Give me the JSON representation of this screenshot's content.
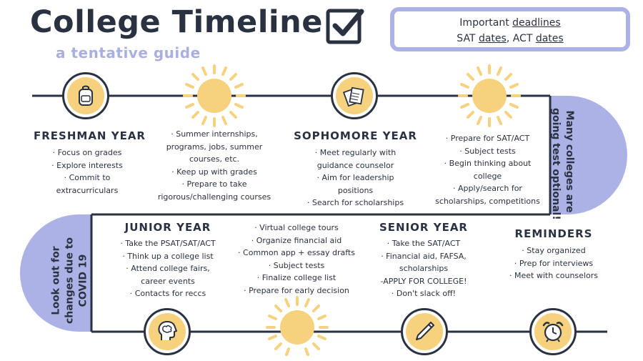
{
  "header": {
    "title": "College Timeline",
    "subtitle": "a tentative guide"
  },
  "deadlines": {
    "line1_prefix": "Important ",
    "line1_link": "deadlines",
    "line2_sat": "SAT ",
    "line2_sat_link": "dates",
    "line2_sep": ", ACT ",
    "line2_act_link": "dates"
  },
  "side_notes": {
    "right_line1": "Many colleges are",
    "right_line2": "going test optional!",
    "left_line1": "Look out for",
    "left_line2": "changes due to",
    "left_line3": "COVID 19"
  },
  "sections": {
    "freshman": {
      "heading": "FRESHMAN YEAR",
      "items": [
        "· Focus on grades",
        "· Explore interests",
        "· Commit to",
        "extracurriculars"
      ]
    },
    "summer1": {
      "items": [
        "· Summer internships,",
        "programs, jobs, summer",
        "courses, etc.",
        "· Keep up with grades",
        "· Prepare to take",
        "rigorous/challenging courses"
      ]
    },
    "sophomore": {
      "heading": "SOPHOMORE YEAR",
      "items": [
        "· Meet regularly with",
        "guidance counselor",
        "· Aim for leadership",
        "positions",
        "· Search for scholarships"
      ]
    },
    "summer2": {
      "items": [
        "· Prepare for SAT/ACT",
        "· Subject tests",
        "· Begin thinking about",
        "college",
        "· Apply/search for",
        "scholarships, competitions"
      ]
    },
    "junior": {
      "heading": "JUNIOR YEAR",
      "items": [
        "· Take the PSAT/SAT/ACT",
        "· Think up a college list",
        "· Attend college fairs,",
        "career events",
        "· Contacts for reccs"
      ]
    },
    "summer3": {
      "items": [
        "· Virtual college tours",
        "· Organize financial aid",
        "· Common app + essay drafts",
        "· Subject tests",
        "· Finalize college list",
        "· Prepare for early decision"
      ]
    },
    "senior": {
      "heading": "SENIOR YEAR",
      "items": [
        "· Take the SAT/ACT",
        "· Financial aid, FAFSA,",
        "scholarships",
        "-APPLY FOR COLLEGE!",
        "· Don't slack off!"
      ]
    },
    "reminders": {
      "heading": "REMINDERS",
      "items": [
        "· Stay organized",
        "· Prep for interviews",
        "· Meet with counselors"
      ]
    }
  },
  "colors": {
    "navy": "#2a3140",
    "lavender": "#adb2e6",
    "sun": "#f6d27e"
  },
  "icons": {
    "header_checkbox": "checkbox-checked-icon",
    "freshman": "backpack-icon",
    "sophomore": "notebooks-icon",
    "junior": "brain-head-icon",
    "senior": "pencil-icon",
    "reminders": "alarm-clock-icon",
    "summer": "sun-icon"
  }
}
